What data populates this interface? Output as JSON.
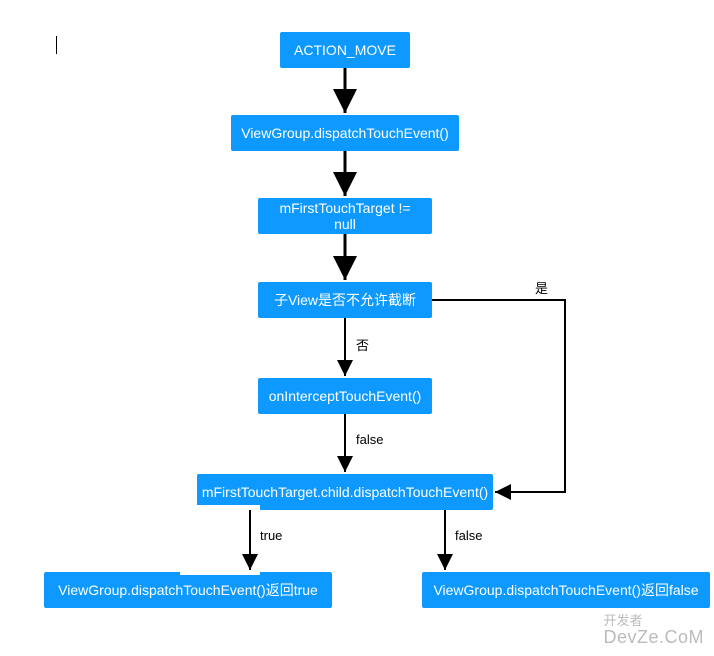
{
  "chart_data": {
    "type": "flowchart",
    "nodes": [
      {
        "id": "n1",
        "label": "ACTION_MOVE"
      },
      {
        "id": "n2",
        "label": "ViewGroup.dispatchTouchEvent()"
      },
      {
        "id": "n3",
        "label": "mFirstTouchTarget != null"
      },
      {
        "id": "n4",
        "label": "子View是否不允许截断"
      },
      {
        "id": "n5",
        "label": "onInterceptTouchEvent()"
      },
      {
        "id": "n6",
        "label": "mFirstTouchTarget.child.dispatchTouchEvent()"
      },
      {
        "id": "n7",
        "label": "ViewGroup.dispatchTouchEvent()返回true"
      },
      {
        "id": "n8",
        "label": "ViewGroup.dispatchTouchEvent()返回false"
      }
    ],
    "edges": [
      {
        "from": "n1",
        "to": "n2",
        "label": ""
      },
      {
        "from": "n2",
        "to": "n3",
        "label": ""
      },
      {
        "from": "n3",
        "to": "n4",
        "label": ""
      },
      {
        "from": "n4",
        "to": "n5",
        "label": "否"
      },
      {
        "from": "n4",
        "to": "n6",
        "label": "是"
      },
      {
        "from": "n5",
        "to": "n6",
        "label": "false"
      },
      {
        "from": "n6",
        "to": "n7",
        "label": "true"
      },
      {
        "from": "n6",
        "to": "n8",
        "label": "false"
      }
    ]
  },
  "watermark": {
    "line1": "开发者",
    "line2": "DevZe.CoM"
  }
}
